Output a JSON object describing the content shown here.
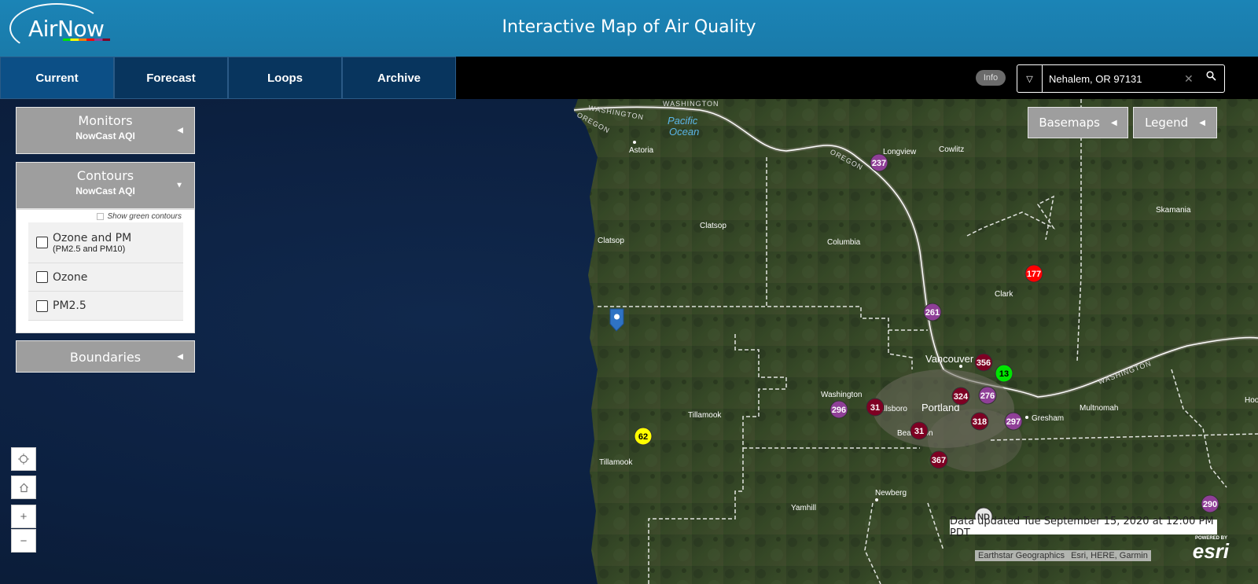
{
  "header": {
    "logo_text": "AirNow",
    "title": "Interactive Map of Air Quality"
  },
  "nav": {
    "tabs": [
      {
        "label": "Current",
        "active": true
      },
      {
        "label": "Forecast",
        "active": false
      },
      {
        "label": "Loops",
        "active": false
      },
      {
        "label": "Archive",
        "active": false
      }
    ],
    "info_label": "Info"
  },
  "search": {
    "value": "Nehalem, OR 97131",
    "clear_icon": "close-icon",
    "search_icon": "search-icon"
  },
  "panels": {
    "monitors": {
      "title": "Monitors",
      "subtitle": "NowCast AQI"
    },
    "contours": {
      "title": "Contours",
      "subtitle": "NowCast AQI",
      "green_option": "Show green contours",
      "options": [
        {
          "label": "Ozone and PM",
          "sub": "(PM2.5 and PM10)"
        },
        {
          "label": "Ozone",
          "sub": ""
        },
        {
          "label": "PM2.5",
          "sub": ""
        }
      ]
    },
    "boundaries": {
      "title": "Boundaries"
    }
  },
  "map_tools": {
    "basemaps": "Basemaps",
    "legend": "Legend"
  },
  "map_controls": {
    "zoom_in": "+",
    "zoom_out": "−"
  },
  "place_labels": {
    "washington_1": "WASHINGTON",
    "washington_2": "WASHINGTON",
    "washington_3": "WASHINGTON",
    "oregon_1": "OREGON",
    "oregon_2": "OREGON",
    "pacific": "Pacific",
    "ocean": "Ocean",
    "astoria": "Astoria",
    "longview": "Longview",
    "cowlitz": "Cowlitz",
    "clatsop_1": "Clatsop",
    "clatsop_2": "Clatsop",
    "columbia": "Columbia",
    "skamania": "Skamania",
    "clark": "Clark",
    "vancouver": "Vancouver",
    "washington_county": "Washington",
    "hillsboro": "Hillsboro",
    "portland": "Portland",
    "gresham": "Gresham",
    "multnomah": "Multnomah",
    "beaverton": "Beaverton",
    "tillamook_county": "Tillamook",
    "tillamook_city": "Tillamook",
    "yamhill": "Yamhill",
    "newberg": "Newberg",
    "hood": "Hoo"
  },
  "monitors": [
    {
      "value": "62",
      "color": "#ffff00",
      "text_color": "#000000"
    },
    {
      "value": "237",
      "color": "#8f3f97",
      "text_color": "#ffffff"
    },
    {
      "value": "177",
      "color": "#ff0000",
      "text_color": "#ffffff"
    },
    {
      "value": "261",
      "color": "#8f3f97",
      "text_color": "#ffffff"
    },
    {
      "value": "356",
      "color": "#7e0023",
      "text_color": "#ffffff"
    },
    {
      "value": "13",
      "color": "#00e400",
      "text_color": "#000000"
    },
    {
      "value": "324",
      "color": "#7e0023",
      "text_color": "#ffffff"
    },
    {
      "value": "276",
      "color": "#8f3f97",
      "text_color": "#ffffff"
    },
    {
      "value": "296",
      "color": "#8f3f97",
      "text_color": "#ffffff"
    },
    {
      "value": "31",
      "color": "#7e0023",
      "text_color": "#ffffff"
    },
    {
      "value": "318",
      "color": "#7e0023",
      "text_color": "#ffffff"
    },
    {
      "value": "297",
      "color": "#8f3f97",
      "text_color": "#ffffff"
    },
    {
      "value": "31",
      "color": "#7e0023",
      "text_color": "#ffffff"
    },
    {
      "value": "367",
      "color": "#7e0023",
      "text_color": "#ffffff"
    },
    {
      "value": "ND",
      "color": "#e8e8e8",
      "text_color": "#333333"
    },
    {
      "value": "290",
      "color": "#8f3f97",
      "text_color": "#ffffff"
    }
  ],
  "footer": {
    "updated": "Data updated Tue September 15, 2020 at 12:00 PM PDT",
    "attribution_1": "Earthstar Geographics",
    "attribution_2": "Esri, HERE, Garmin",
    "esri_powered": "POWERED BY",
    "esri_name": "esri"
  }
}
